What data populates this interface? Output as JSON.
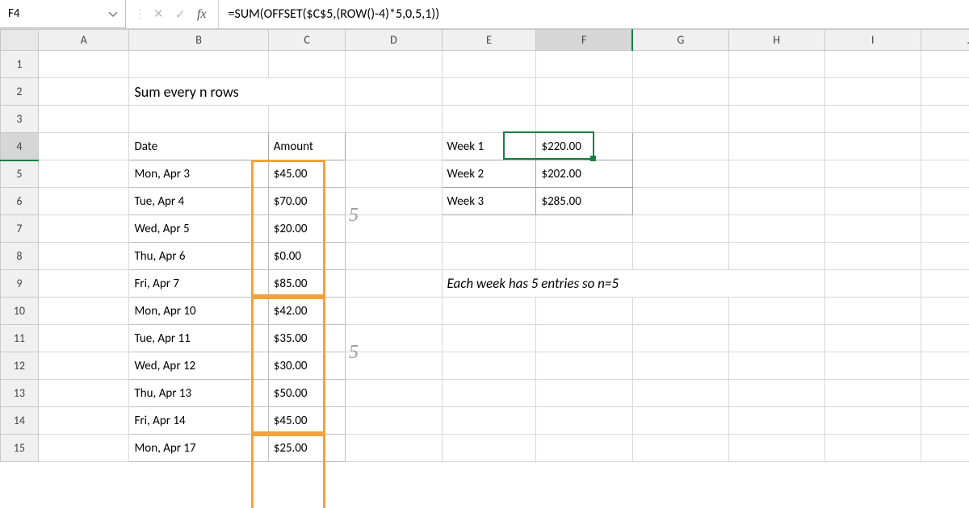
{
  "namebox": "F4",
  "formula": "=SUM(OFFSET($C$5,(ROW()-4)*5,0,5,1))",
  "columns": [
    "A",
    "B",
    "C",
    "D",
    "E",
    "F",
    "G",
    "H",
    "I",
    "J"
  ],
  "rows": [
    "1",
    "2",
    "3",
    "4",
    "5",
    "6",
    "7",
    "8",
    "9",
    "10",
    "11",
    "12",
    "13",
    "14",
    "15"
  ],
  "title": "Sum every n rows",
  "table_headers": {
    "date": "Date",
    "amount": "Amount"
  },
  "rows_data": [
    {
      "date": "Mon, Apr 3",
      "amount": "$45.00"
    },
    {
      "date": "Tue, Apr 4",
      "amount": "$70.00"
    },
    {
      "date": "Wed, Apr 5",
      "amount": "$20.00"
    },
    {
      "date": "Thu, Apr 6",
      "amount": "$0.00"
    },
    {
      "date": "Fri, Apr 7",
      "amount": "$85.00"
    },
    {
      "date": "Mon, Apr 10",
      "amount": "$42.00"
    },
    {
      "date": "Tue, Apr 11",
      "amount": "$35.00"
    },
    {
      "date": "Wed, Apr 12",
      "amount": "$30.00"
    },
    {
      "date": "Thu, Apr 13",
      "amount": "$50.00"
    },
    {
      "date": "Fri, Apr 14",
      "amount": "$45.00"
    },
    {
      "date": "Mon, Apr 17",
      "amount": "$25.00"
    }
  ],
  "weeks": [
    {
      "label": "Week 1",
      "value": "$220.00"
    },
    {
      "label": "Week 2",
      "value": "$202.00"
    },
    {
      "label": "Week 3",
      "value": "$285.00"
    }
  ],
  "note": "Each week has 5 entries so n=5",
  "annotations": {
    "five_a": "5",
    "five_b": "5"
  },
  "icons": {
    "fx": "fx"
  },
  "active_cell": {
    "col": "F",
    "row": 4
  },
  "chart_data": {
    "type": "table",
    "title": "Sum every n rows",
    "columns": [
      "Date",
      "Amount"
    ],
    "rows": [
      [
        "Mon, Apr 3",
        45.0
      ],
      [
        "Tue, Apr 4",
        70.0
      ],
      [
        "Wed, Apr 5",
        20.0
      ],
      [
        "Thu, Apr 6",
        0.0
      ],
      [
        "Fri, Apr 7",
        85.0
      ],
      [
        "Mon, Apr 10",
        42.0
      ],
      [
        "Tue, Apr 11",
        35.0
      ],
      [
        "Wed, Apr 12",
        30.0
      ],
      [
        "Thu, Apr 13",
        50.0
      ],
      [
        "Fri, Apr 14",
        45.0
      ],
      [
        "Mon, Apr 17",
        25.0
      ]
    ],
    "summary": [
      [
        "Week 1",
        220.0
      ],
      [
        "Week 2",
        202.0
      ],
      [
        "Week 3",
        285.0
      ]
    ],
    "n": 5
  }
}
